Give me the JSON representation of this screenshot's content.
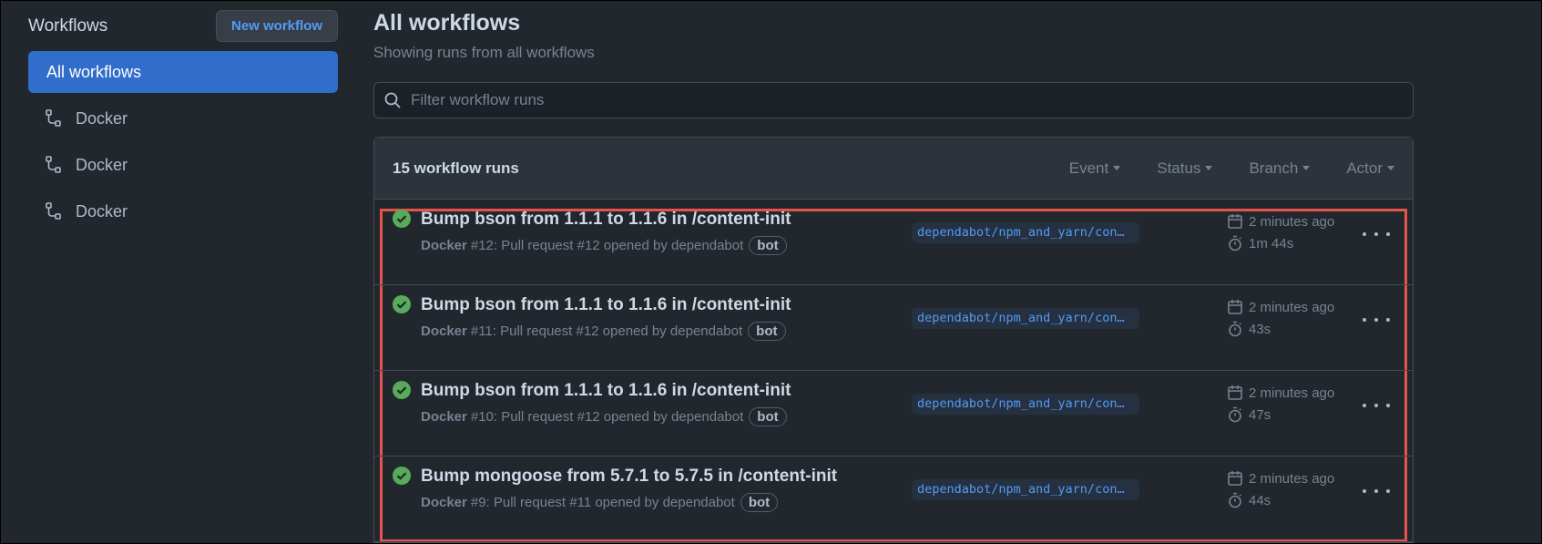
{
  "sidebar": {
    "title": "Workflows",
    "new_button": "New workflow",
    "items": [
      {
        "label": "All workflows",
        "active": true
      },
      {
        "label": "Docker",
        "icon": "workflow-icon"
      },
      {
        "label": "Docker",
        "icon": "workflow-icon"
      },
      {
        "label": "Docker",
        "icon": "workflow-icon"
      }
    ]
  },
  "main": {
    "title": "All workflows",
    "subtitle": "Showing runs from all workflows",
    "filter_placeholder": "Filter workflow runs",
    "runs_count": "15 workflow runs",
    "filters": [
      "Event",
      "Status",
      "Branch",
      "Actor"
    ],
    "runs": [
      {
        "title": "Bump bson from 1.1.1 to 1.1.6 in /content-init",
        "workflow": "Docker",
        "meta": "#12: Pull request #12 opened by dependabot",
        "badge": "bot",
        "branch": "dependabot/npm_and_yarn/con…",
        "when": "2 minutes ago",
        "duration": "1m 44s",
        "status": "success"
      },
      {
        "title": "Bump bson from 1.1.1 to 1.1.6 in /content-init",
        "workflow": "Docker",
        "meta": "#11: Pull request #12 opened by dependabot",
        "badge": "bot",
        "branch": "dependabot/npm_and_yarn/con…",
        "when": "2 minutes ago",
        "duration": "43s",
        "status": "success"
      },
      {
        "title": "Bump bson from 1.1.1 to 1.1.6 in /content-init",
        "workflow": "Docker",
        "meta": "#10: Pull request #12 opened by dependabot",
        "badge": "bot",
        "branch": "dependabot/npm_and_yarn/con…",
        "when": "2 minutes ago",
        "duration": "47s",
        "status": "success"
      },
      {
        "title": "Bump mongoose from 5.7.1 to 5.7.5 in /content-init",
        "workflow": "Docker",
        "meta": "#9: Pull request #11 opened by dependabot",
        "badge": "bot",
        "branch": "dependabot/npm_and_yarn/con…",
        "when": "2 minutes ago",
        "duration": "44s",
        "status": "success"
      }
    ]
  },
  "colors": {
    "accent": "#316dca",
    "link": "#539bf5",
    "success": "#57ab5a",
    "highlight": "#e5534b"
  }
}
